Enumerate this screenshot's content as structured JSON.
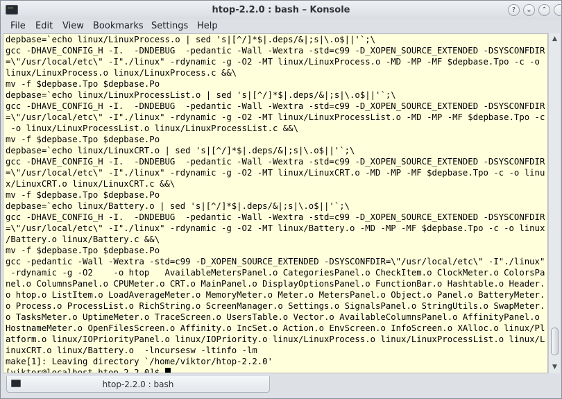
{
  "window": {
    "title": "htop-2.2.0 : bash – Konsole",
    "controls": [
      "help-button",
      "minimize-button",
      "maximize-button",
      "close-button"
    ]
  },
  "menu": [
    "File",
    "Edit",
    "View",
    "Bookmarks",
    "Settings",
    "Help"
  ],
  "terminal": {
    "lines": [
      "depbase=`echo linux/LinuxProcess.o | sed 's|[^/]*$|.deps/&|;s|\\.o$||'`;\\",
      "gcc -DHAVE_CONFIG_H -I.  -DNDEBUG  -pedantic -Wall -Wextra -std=c99 -D_XOPEN_SOURCE_EXTENDED -DSYSCONFDIR",
      "=\\\"/usr/local/etc\\\" -I\"./linux\" -rdynamic -g -O2 -MT linux/LinuxProcess.o -MD -MP -MF $depbase.Tpo -c -o",
      "linux/LinuxProcess.o linux/LinuxProcess.c &&\\",
      "mv -f $depbase.Tpo $depbase.Po",
      "depbase=`echo linux/LinuxProcessList.o | sed 's|[^/]*$|.deps/&|;s|\\.o$||'`;\\",
      "gcc -DHAVE_CONFIG_H -I.  -DNDEBUG  -pedantic -Wall -Wextra -std=c99 -D_XOPEN_SOURCE_EXTENDED -DSYSCONFDIR",
      "=\\\"/usr/local/etc\\\" -I\"./linux\" -rdynamic -g -O2 -MT linux/LinuxProcessList.o -MD -MP -MF $depbase.Tpo -c",
      " -o linux/LinuxProcessList.o linux/LinuxProcessList.c &&\\",
      "mv -f $depbase.Tpo $depbase.Po",
      "depbase=`echo linux/LinuxCRT.o | sed 's|[^/]*$|.deps/&|;s|\\.o$||'`;\\",
      "gcc -DHAVE_CONFIG_H -I.  -DNDEBUG  -pedantic -Wall -Wextra -std=c99 -D_XOPEN_SOURCE_EXTENDED -DSYSCONFDIR",
      "=\\\"/usr/local/etc\\\" -I\"./linux\" -rdynamic -g -O2 -MT linux/LinuxCRT.o -MD -MP -MF $depbase.Tpo -c -o linu",
      "x/LinuxCRT.o linux/LinuxCRT.c &&\\",
      "mv -f $depbase.Tpo $depbase.Po",
      "depbase=`echo linux/Battery.o | sed 's|[^/]*$|.deps/&|;s|\\.o$||'`;\\",
      "gcc -DHAVE_CONFIG_H -I.  -DNDEBUG  -pedantic -Wall -Wextra -std=c99 -D_XOPEN_SOURCE_EXTENDED -DSYSCONFDIR",
      "=\\\"/usr/local/etc\\\" -I\"./linux\" -rdynamic -g -O2 -MT linux/Battery.o -MD -MP -MF $depbase.Tpo -c -o linux",
      "/Battery.o linux/Battery.c &&\\",
      "mv -f $depbase.Tpo $depbase.Po",
      "gcc -pedantic -Wall -Wextra -std=c99 -D_XOPEN_SOURCE_EXTENDED -DSYSCONFDIR=\\\"/usr/local/etc\\\" -I\"./linux\"",
      " -rdynamic -g -O2    -o htop   AvailableMetersPanel.o CategoriesPanel.o CheckItem.o ClockMeter.o ColorsPa",
      "nel.o ColumnsPanel.o CPUMeter.o CRT.o MainPanel.o DisplayOptionsPanel.o FunctionBar.o Hashtable.o Header.",
      "o htop.o ListItem.o LoadAverageMeter.o MemoryMeter.o Meter.o MetersPanel.o Object.o Panel.o BatteryMeter.",
      "o Process.o ProcessList.o RichString.o ScreenManager.o Settings.o SignalsPanel.o StringUtils.o SwapMeter.",
      "o TasksMeter.o UptimeMeter.o TraceScreen.o UsersTable.o Vector.o AvailableColumnsPanel.o AffinityPanel.o",
      "HostnameMeter.o OpenFilesScreen.o Affinity.o IncSet.o Action.o EnvScreen.o InfoScreen.o XAlloc.o linux/Pl",
      "atform.o linux/IOPriorityPanel.o linux/IOPriority.o linux/LinuxProcess.o linux/LinuxProcessList.o linux/L",
      "inuxCRT.o linux/Battery.o  -lncursesw -ltinfo -lm",
      "make[1]: Leaving directory `/home/viktor/htop-2.2.0'"
    ],
    "prompt": "[viktor@localhost htop-2.2.0]$ "
  },
  "tab": {
    "label": "htop-2.2.0 : bash"
  },
  "colors": {
    "terminal_bg": "#ffffdc",
    "terminal_fg": "#000000",
    "chrome": "#dde1e6"
  }
}
